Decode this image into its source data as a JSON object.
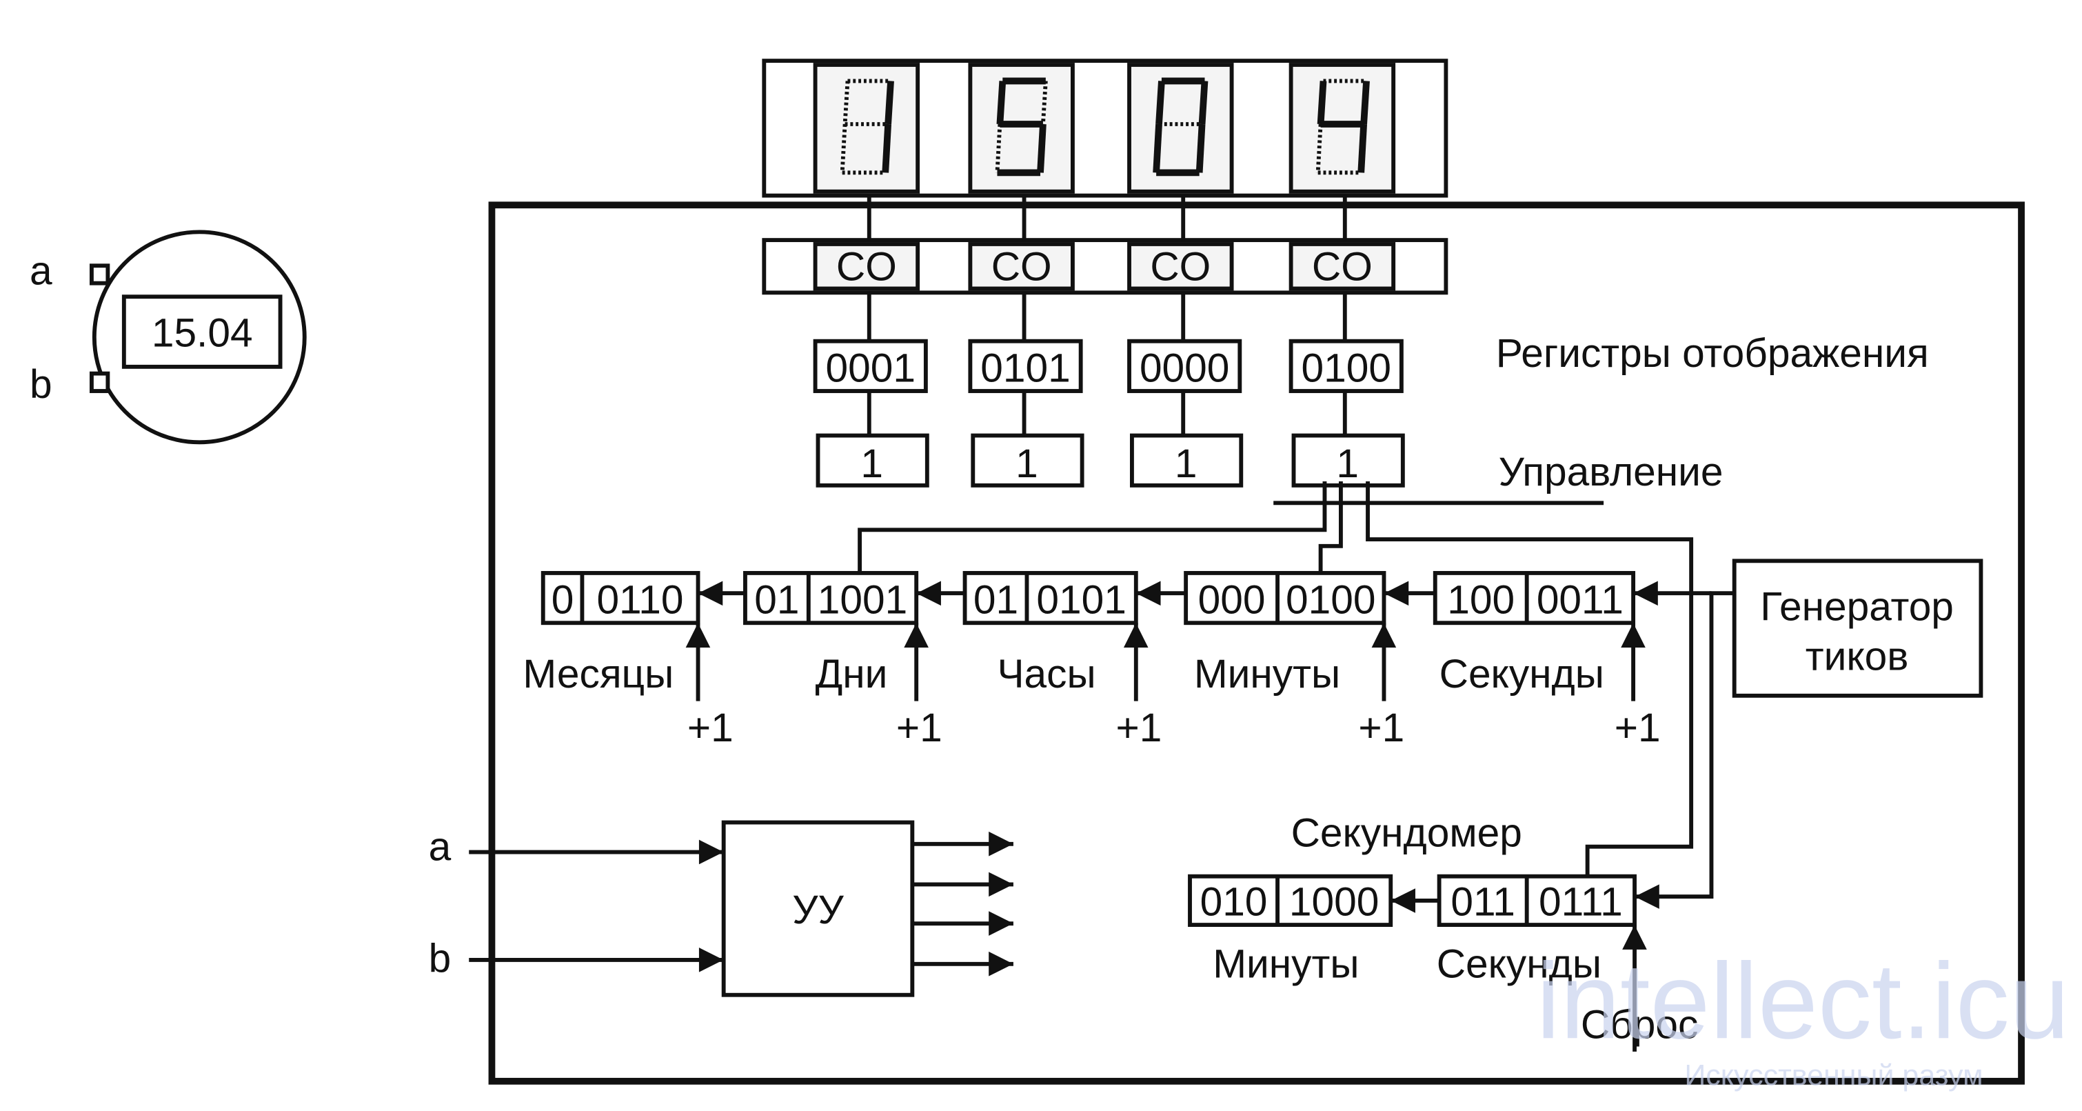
{
  "watch": {
    "display": "15.04",
    "button_a": "a",
    "button_b": "b"
  },
  "display_digits": [
    "1",
    "5",
    "0",
    "4"
  ],
  "decoders": [
    "CO",
    "CO",
    "CO",
    "CO"
  ],
  "display_registers": [
    "0001",
    "0101",
    "0000",
    "0100"
  ],
  "control_bits": [
    "1",
    "1",
    "1",
    "1"
  ],
  "labels": {
    "display_registers": "Регистры отображения",
    "control": "Управление",
    "generator_line1": "Генератор",
    "generator_line2": "тиков",
    "stopwatch": "Секундомер",
    "reset": "Сброс",
    "control_unit": "УУ",
    "input_a": "a",
    "input_b": "b"
  },
  "counters": [
    {
      "label": "Месяцы",
      "high": "0",
      "low": "0110",
      "inc": "+1"
    },
    {
      "label": "Дни",
      "high": "01",
      "low": "1001",
      "inc": "+1"
    },
    {
      "label": "Часы",
      "high": "01",
      "low": "0101",
      "inc": "+1"
    },
    {
      "label": "Минуты",
      "high": "000",
      "low": "0100",
      "inc": "+1"
    },
    {
      "label": "Секунды",
      "high": "100",
      "low": "0011",
      "inc": "+1"
    }
  ],
  "stopwatch_counters": [
    {
      "label": "Минуты",
      "high": "010",
      "low": "1000"
    },
    {
      "label": "Секунды",
      "high": "011",
      "low": "0111"
    }
  ],
  "watermark": {
    "main": "intellect.icu",
    "sub": "Искусственный разум"
  }
}
